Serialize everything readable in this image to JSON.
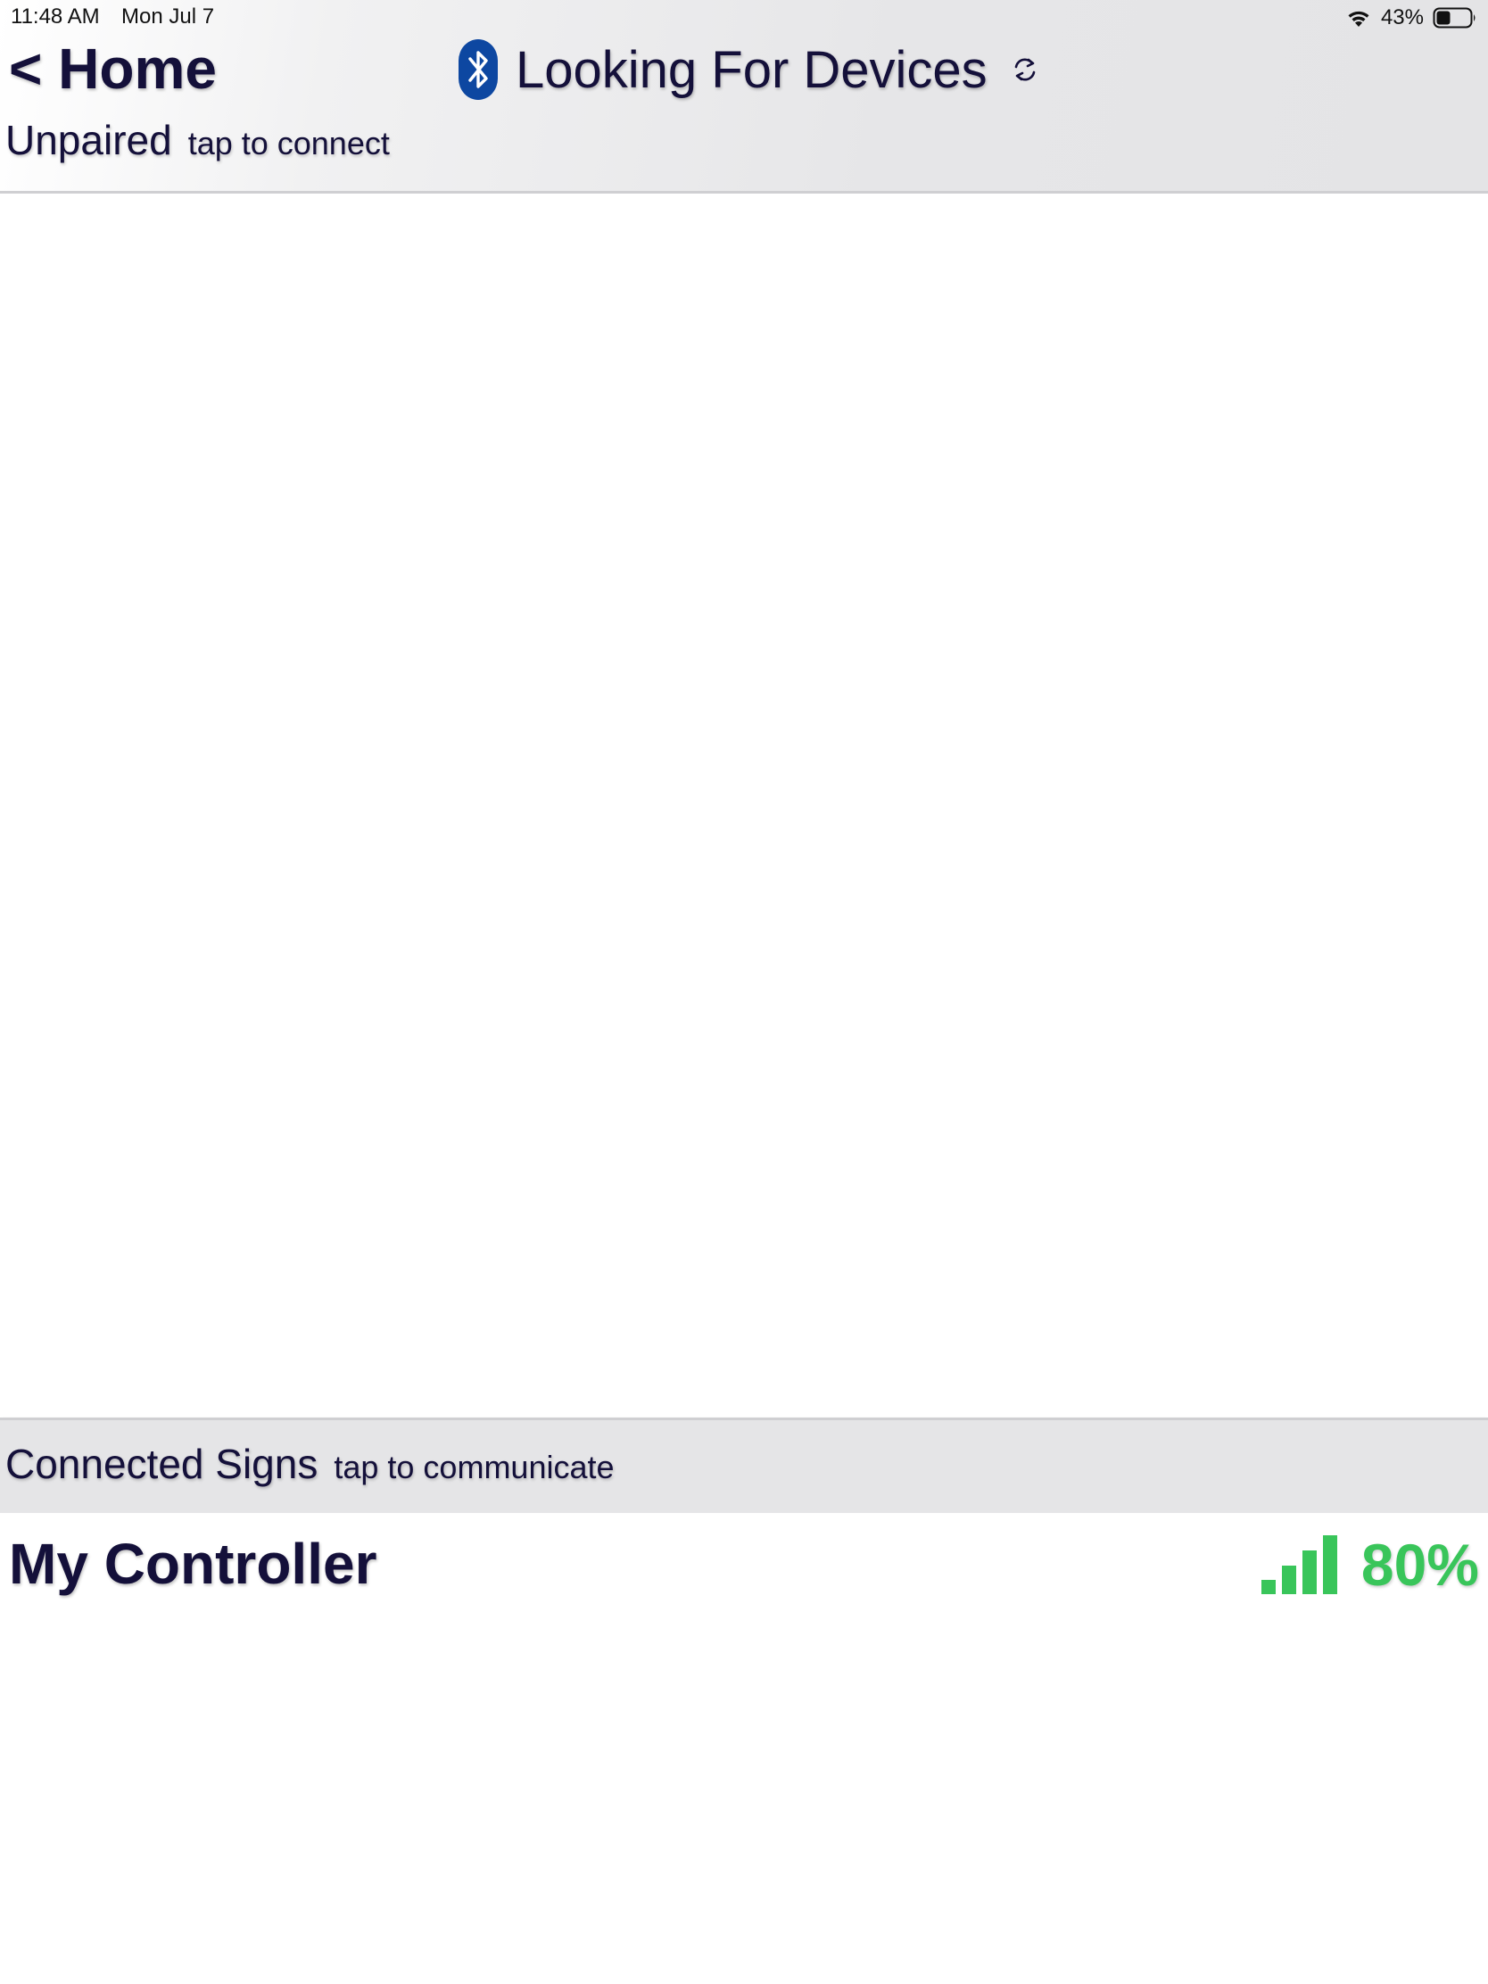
{
  "status_bar": {
    "time": "11:48 AM",
    "date": "Mon Jul 7",
    "battery_percent": "43%",
    "battery_level": 0.43,
    "icons": [
      "wifi-icon",
      "battery-icon"
    ]
  },
  "header": {
    "back_label": "< Home",
    "title": "Looking For Devices",
    "title_icon": "bluetooth-icon",
    "refresh_icon": "refresh-icon"
  },
  "unpaired_section": {
    "label": "Unpaired",
    "hint": "tap to connect",
    "items": []
  },
  "connected_section": {
    "label": "Connected Signs",
    "hint": "tap to communicate",
    "items": [
      {
        "name": "My Controller",
        "signal_percent": "80%",
        "signal_icon": "signal-strength-icon",
        "signal_level": 0.8
      }
    ]
  },
  "colors": {
    "text": "#14103a",
    "bluetooth": "#0d47a1",
    "signal_green": "#39c55a",
    "header_bg": "#e5e5e7"
  }
}
